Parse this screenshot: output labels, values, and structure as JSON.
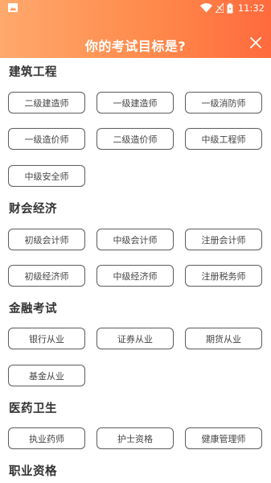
{
  "status": {
    "time": "11:32"
  },
  "header": {
    "title": "你的考试目标是?"
  },
  "sections": [
    {
      "title": "建筑工程",
      "items": [
        "二级建造师",
        "一级建造师",
        "一级消防师",
        "一级造价师",
        "二级造价师",
        "中级工程师",
        "中级安全师"
      ]
    },
    {
      "title": "财会经济",
      "items": [
        "初级会计师",
        "中级会计师",
        "注册会计师",
        "初级经济师",
        "中级经济师",
        "注册税务师"
      ]
    },
    {
      "title": "金融考试",
      "items": [
        "银行从业",
        "证券从业",
        "期货从业",
        "基金从业"
      ]
    },
    {
      "title": "医药卫生",
      "items": [
        "执业药师",
        "护士资格",
        "健康管理师"
      ]
    },
    {
      "title": "职业资格",
      "items": []
    }
  ],
  "icons": {
    "close": "close-icon",
    "image": "image-icon",
    "wifi": "wifi-icon",
    "signal": "signal-icon",
    "battery": "battery-icon"
  },
  "colors": {
    "header_start": "#ffa96c",
    "header_end": "#ff6a3d",
    "chip_border": "#5c5c5c"
  }
}
